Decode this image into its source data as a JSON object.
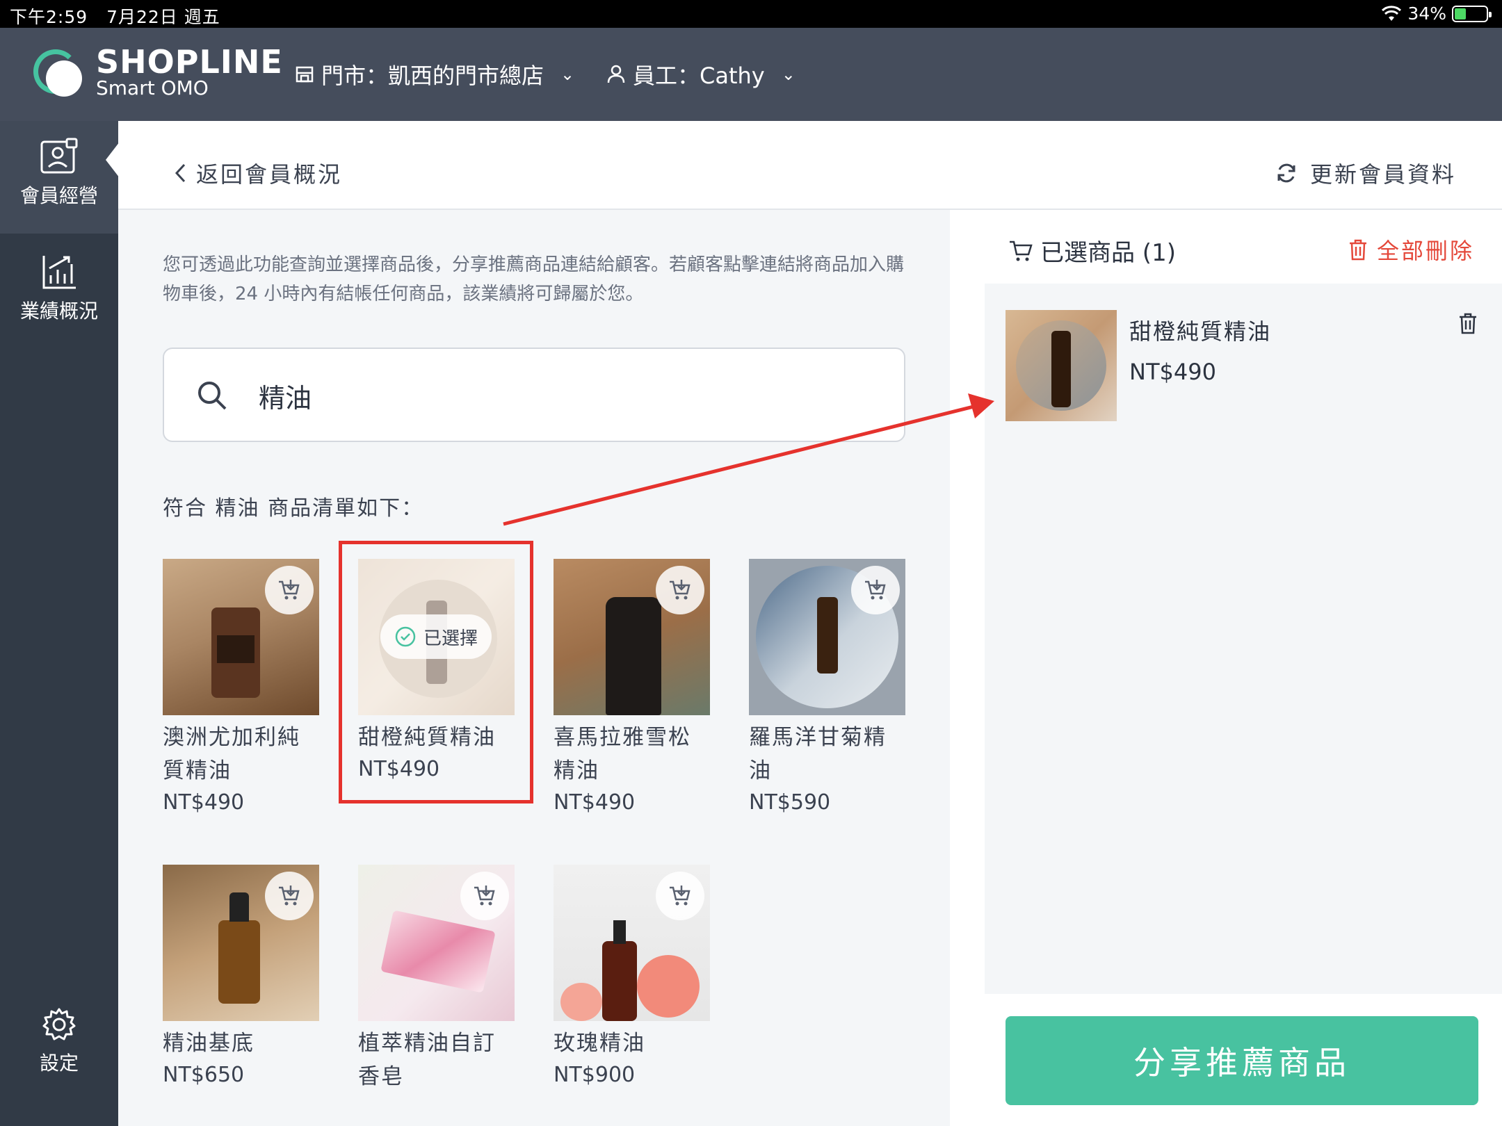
{
  "status_bar": {
    "time": "下午2:59",
    "date": "7月22日 週五",
    "battery": "34%",
    "battery_level": 0.34
  },
  "header": {
    "logo_brand": "SHOPLINE",
    "logo_sub": "Smart OMO",
    "store_selector": "門市：凱西的門市總店",
    "staff_selector": "員工：Cathy"
  },
  "sidebar": {
    "items": [
      {
        "label": "會員經營",
        "icon": "member-card-icon",
        "active": true
      },
      {
        "label": "業績概況",
        "icon": "chart-icon",
        "active": false
      }
    ],
    "settings_label": "設定"
  },
  "topbar": {
    "back_label": "返回會員概況",
    "refresh_label": "更新會員資料"
  },
  "main": {
    "description": "您可透過此功能查詢並選擇商品後，分享推薦商品連結給顧客。若顧客點擊連結將商品加入購物車後，24 小時內有結帳任何商品，該業績將可歸屬於您。",
    "search_value": "精油",
    "result_title": "符合 精油 商品清單如下：",
    "selected_chip_label": "已選擇",
    "products": [
      {
        "name": "澳洲尤加利純質精油",
        "price": "NT$490",
        "selected": false
      },
      {
        "name": "甜橙純質精油",
        "price": "NT$490",
        "selected": true
      },
      {
        "name": "喜馬拉雅雪松精油",
        "price": "NT$490",
        "selected": false
      },
      {
        "name": "羅馬洋甘菊精油",
        "price": "NT$590",
        "selected": false
      },
      {
        "name": "精油基底",
        "price": "NT$650",
        "selected": false
      },
      {
        "name": "植萃精油自訂香皂",
        "price": "",
        "selected": false
      },
      {
        "name": "玫瑰精油",
        "price": "NT$900",
        "selected": false
      }
    ]
  },
  "panel": {
    "title": "已選商品 (1)",
    "delete_all_label": "全部刪除",
    "selected_item": {
      "name": "甜橙純質精油",
      "price": "NT$490"
    },
    "share_button_label": "分享推薦商品"
  },
  "colors": {
    "accent": "#48c2a0",
    "danger": "#e4483a",
    "header": "#454d5c",
    "sidebar": "#313a46",
    "annotation": "#e5322d"
  }
}
